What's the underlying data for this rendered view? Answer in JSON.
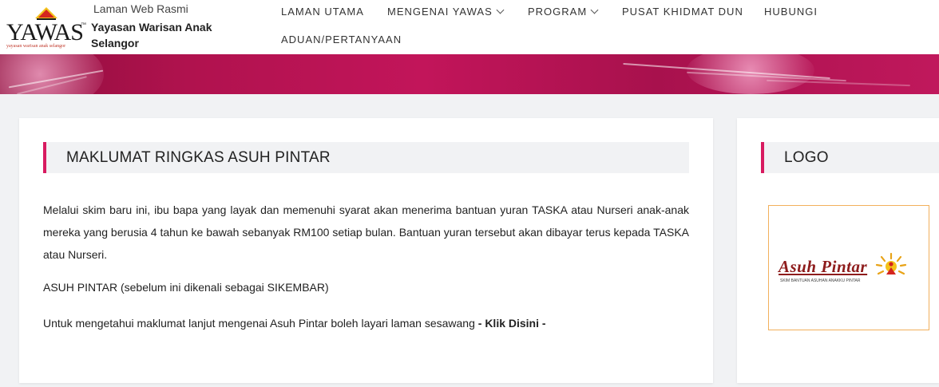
{
  "header": {
    "logo_text": "YAWAS",
    "logo_tm": "™",
    "logo_tagline": "yayasan warisan anak selangor",
    "site_subtitle": "Laman Web Rasmi",
    "site_title": "Yayasan Warisan Anak Selangor"
  },
  "nav": {
    "items": [
      {
        "label": "LAMAN UTAMA",
        "has_dropdown": false
      },
      {
        "label": "MENGENAI YAWAS",
        "has_dropdown": true
      },
      {
        "label": "PROGRAM",
        "has_dropdown": true
      },
      {
        "label": "PUSAT KHIDMAT DUN",
        "has_dropdown": false
      },
      {
        "label": "HUBUNGI",
        "has_dropdown": false
      },
      {
        "label": "ADUAN/PERTANYAAN",
        "has_dropdown": false
      }
    ]
  },
  "main": {
    "heading": "MAKLUMAT RINGKAS ASUH PINTAR",
    "paragraph1": "Melalui skim baru ini, ibu bapa yang layak dan memenuhi syarat akan menerima bantuan yuran TASKA atau Nurseri anak-anak mereka yang berusia 4 tahun ke bawah sebanyak RM100 setiap bulan. Bantuan yuran tersebut akan dibayar terus kepada TASKA atau Nurseri.",
    "paragraph2": "ASUH PINTAR (sebelum ini dikenali sebagai SIKEMBAR)",
    "paragraph3_text": "Untuk mengetahui maklumat lanjut mengenai Asuh Pintar boleh layari laman sesawang ",
    "paragraph3_link": "- Klik Disini -"
  },
  "sidebar": {
    "heading": "LOGO",
    "logo_title": "Asuh Pintar",
    "logo_tagline": "SKIM BANTUAN ASUHAN ANAKKU PINTAR"
  },
  "colors": {
    "accent": "#d81b60",
    "banner": "#b0124e",
    "section_bg": "#f1f2f4",
    "logo_border": "#f2b05c",
    "asuh_pintar_red": "#8e1c1c"
  },
  "icons": {
    "dropdown": "chevron-down-icon",
    "logo_mark": "yawas-roof-icon",
    "asuh_sun": "sun-figure-icon"
  }
}
